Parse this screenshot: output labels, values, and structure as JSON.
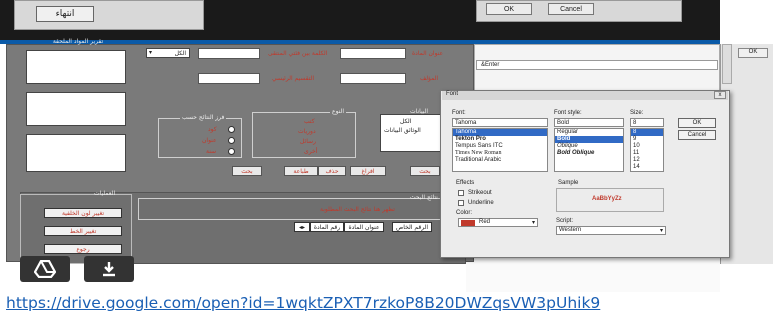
{
  "top": {
    "finish_button": "انتهاء",
    "right_buttons": [
      "OK",
      "Cancel"
    ]
  },
  "form": {
    "side_panel_title": "تقرير المواد الملحقة",
    "dropdown_value": "الكل",
    "labels": {
      "field1": "الكلمة بين فئتي المنتقى",
      "field2": "التقسيم الرئيسي",
      "field3": "عنوان المادة",
      "field4": "المؤلف"
    },
    "group_results_title": "فرز النتائج حسب",
    "group_results_options": [
      "كود",
      "عنوان",
      "سنة"
    ],
    "group_type_title": "النوع",
    "group_type_options": [
      "كتب",
      "دوريات",
      "رسائل",
      "أخرى"
    ],
    "data_list_title": "البيانات",
    "data_list_items": [
      "الكل",
      "الوثائق البيانات"
    ],
    "action_buttons": [
      "بحث",
      "طباعة",
      "حذف",
      "افراغ",
      "بحث"
    ],
    "ops_title": "العمليات",
    "ops_buttons": [
      "تغيير لون الخلفية",
      "تغيير الخط",
      "رجوع"
    ],
    "bottom_title": "نتائج البحث",
    "bottom_hint": "تظهر هنا نتائج البحث المطلوبة",
    "tabbar": [
      "رقم المادة",
      "عنوان المادة",
      "الرقم الخاص"
    ]
  },
  "font_dialog": {
    "title": "Font",
    "close": "x",
    "font_label": "Font:",
    "font_value": "Tahoma",
    "fonts": [
      "Tahoma",
      "Tekton Pro",
      "Tempus Sans ITC",
      "Times New Roman",
      "Traditional Arabic"
    ],
    "font_selected": 0,
    "style_label": "Font style:",
    "style_value": "Bold",
    "styles": [
      "Regular",
      "Bold",
      "Oblique",
      "Bold Oblique"
    ],
    "style_selected": 1,
    "size_label": "Size:",
    "size_value": "8",
    "sizes": [
      "8",
      "9",
      "10",
      "11",
      "12",
      "14",
      "16"
    ],
    "size_selected": 0,
    "ok": "OK",
    "cancel": "Cancel",
    "effects_label": "Effects",
    "strikeout": "Strikeout",
    "underline": "Underline",
    "color_label": "Color:",
    "color_value": "Red",
    "color_hex": "#c0392b",
    "sample_label": "Sample",
    "sample_text": "AaBbYyZz",
    "script_label": "Script:",
    "script_value": "Western"
  },
  "editor": {
    "text": "&Enter",
    "right_button": "OK"
  },
  "overlay": {
    "icons": [
      "drive-icon",
      "download-icon"
    ]
  },
  "link": {
    "url": "https://drive.google.com/open?id=1wqktZPXT7rzkoP8B20DWZqsVW3pUhik9"
  }
}
